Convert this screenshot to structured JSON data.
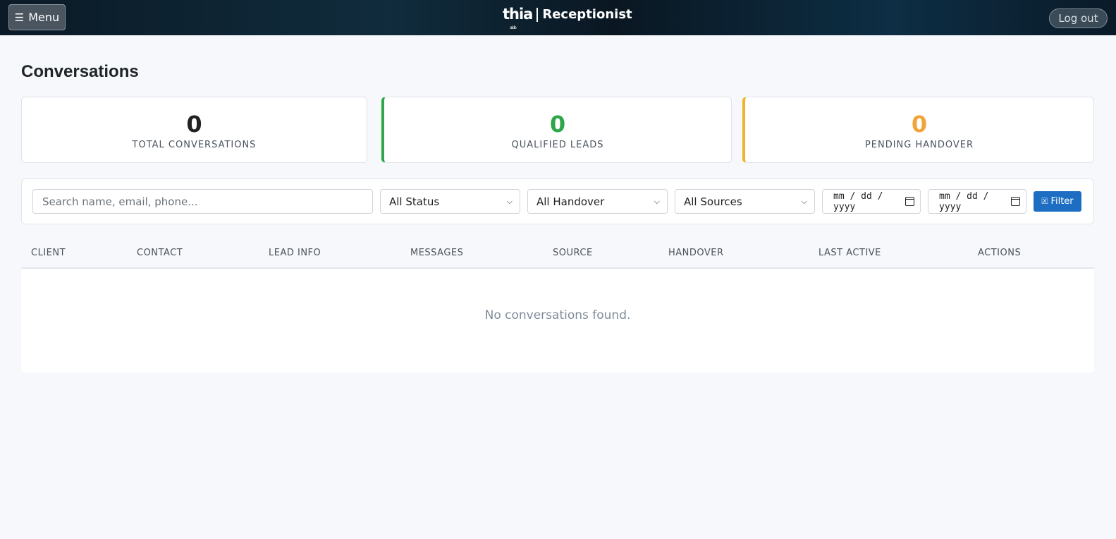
{
  "header": {
    "menu_label": "Menu",
    "menu_icon": "hamburger-icon",
    "logo_brand": "thia",
    "logo_sub": "aide",
    "logo_product": "Receptionist",
    "logout_label": "Log out"
  },
  "page": {
    "title": "Conversations"
  },
  "stats": {
    "total": {
      "value": "0",
      "label": "TOTAL CONVERSATIONS"
    },
    "qualified": {
      "value": "0",
      "label": "QUALIFIED LEADS",
      "accent": "#2ea64a"
    },
    "pending": {
      "value": "0",
      "label": "PENDING HANDOVER",
      "accent": "#f0b429"
    }
  },
  "filters": {
    "search_placeholder": "Search name, email, phone...",
    "status_selected": "All Status",
    "handover_selected": "All Handover",
    "sources_selected": "All Sources",
    "date_from_placeholder": "mm / dd / yyyy",
    "date_to_placeholder": "mm / dd / yyyy",
    "filter_label": "Filter",
    "filter_icon": "filter-icon",
    "filter_color": "#1d6ec2"
  },
  "table": {
    "columns": [
      "CLIENT",
      "CONTACT",
      "LEAD INFO",
      "MESSAGES",
      "SOURCE",
      "HANDOVER",
      "LAST ACTIVE",
      "ACTIONS"
    ],
    "empty_message": "No conversations found."
  }
}
